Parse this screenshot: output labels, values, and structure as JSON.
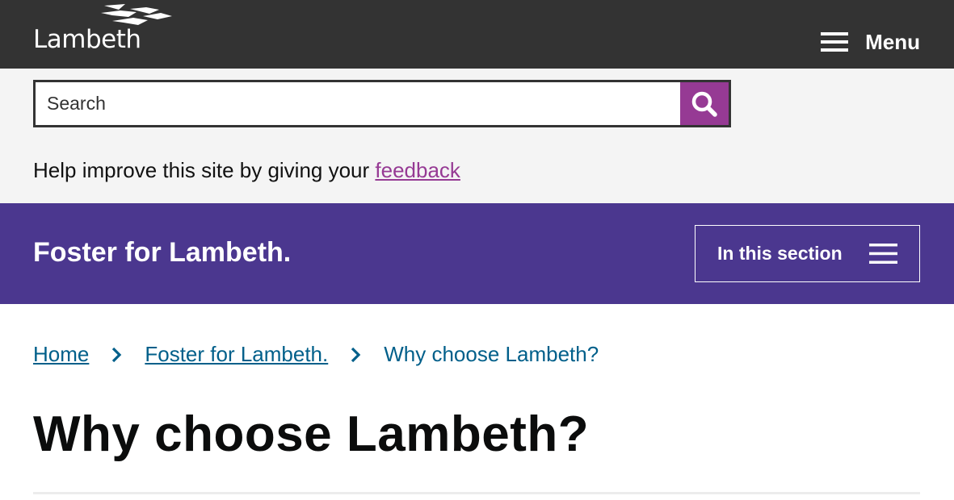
{
  "header": {
    "logo_text": "Lambeth",
    "menu_label": "Menu"
  },
  "search": {
    "placeholder": "Search",
    "value": ""
  },
  "feedback": {
    "prefix": "Help improve this site by giving your ",
    "link_text": "feedback"
  },
  "section": {
    "title": "Foster for Lambeth.",
    "nav_button_label": "In this section"
  },
  "breadcrumb": {
    "items": [
      {
        "label": "Home"
      },
      {
        "label": "Foster for Lambeth."
      },
      {
        "label": "Why choose Lambeth?"
      }
    ]
  },
  "page": {
    "title": "Why choose Lambeth?"
  },
  "colors": {
    "header_bg": "#333333",
    "search_band_bg": "#f4f4f4",
    "search_button": "#963a94",
    "section_bg": "#4b378f",
    "link": "#005f8a",
    "feedback_link": "#963a94"
  },
  "icons": {
    "logo": "lambeth-logo-mark",
    "menu": "hamburger-icon",
    "search": "search-icon",
    "section": "list-lines-icon",
    "separator": "chevron-right-icon"
  }
}
